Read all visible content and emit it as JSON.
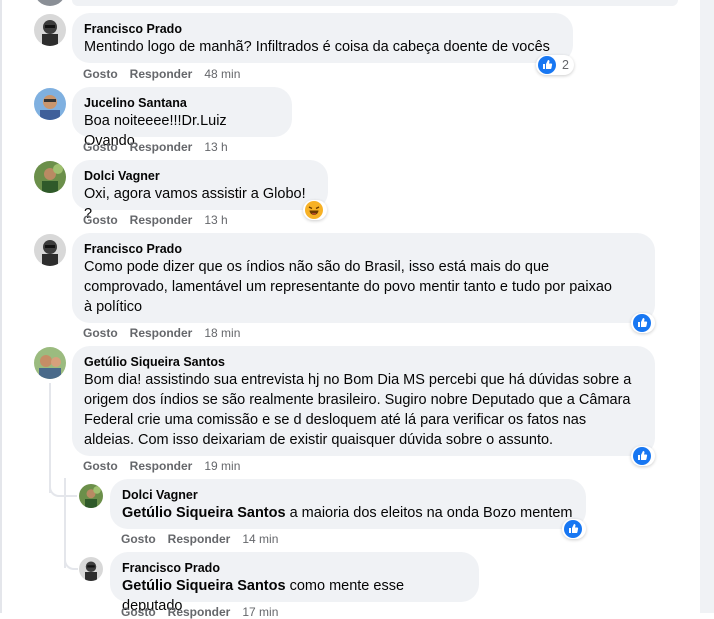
{
  "actions": {
    "like": "Gosto",
    "reply": "Responder"
  },
  "comments": [
    {
      "author": "Francisco Prado",
      "text": "Mentindo logo de manhã? Infiltrados é coisa da cabeça doente de vocês",
      "time": "48 min",
      "reactions": "2"
    },
    {
      "author": "Jucelino Santana",
      "text": "Boa noiteeee!!!Dr.Luiz Ovando",
      "time": "13 h"
    },
    {
      "author": "Dolci Vagner",
      "text": "Oxi, agora vamos assistir a Globo! ?",
      "time": "13 h"
    },
    {
      "author": "Francisco Prado",
      "lines": [
        "Como pode dizer que os índios não são do Brasil, isso está mais do que",
        "comprovado, lamentável um representante do povo mentir tanto e tudo por paixao",
        "à político"
      ],
      "time": "18 min"
    },
    {
      "author": "Getúlio Siqueira Santos",
      "lines": [
        "Bom dia! assistindo sua entrevista hj no Bom Dia MS percebi que há dúvidas sobre a",
        "origem dos índios se são realmente brasileiro. Sugiro nobre Deputado que a Câmara",
        "Federal crie uma comissão e se d desloquem até lá para verificar os fatos nas",
        "aldeias. Com isso deixariam de existir quaisquer dúvida sobre o assunto."
      ],
      "time": "19 min"
    }
  ],
  "replies": [
    {
      "author": "Dolci Vagner",
      "mention": "Getúlio Siqueira Santos",
      "text": " a maioria dos eleitos na onda Bozo mentem",
      "time": "14 min"
    },
    {
      "author": "Francisco Prado",
      "mention": "Getúlio Siqueira Santos",
      "text": " como mente esse deputado",
      "time": "17 min"
    }
  ],
  "icons": {
    "like": "like-icon",
    "haha": "haha-icon"
  },
  "colors": {
    "bubble": "#f0f2f5",
    "like_blue": "#1877f2",
    "meta_gray": "#65676b"
  }
}
